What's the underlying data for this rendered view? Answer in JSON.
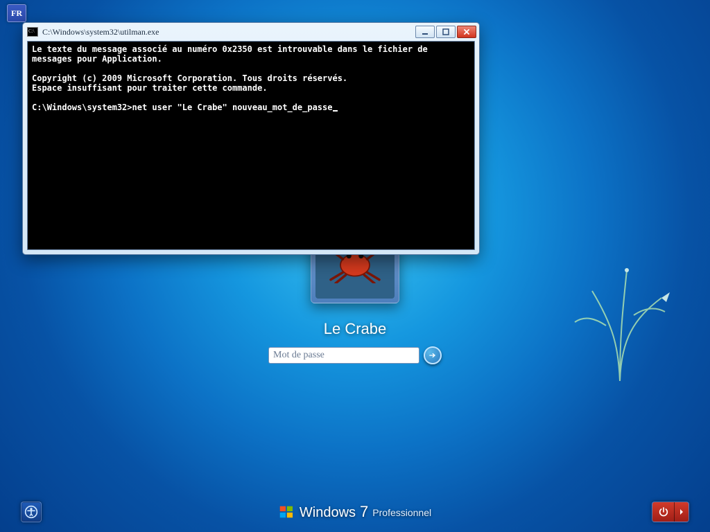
{
  "language_indicator": "FR",
  "login": {
    "username": "Le Crabe",
    "password_placeholder": "Mot de passe"
  },
  "branding": {
    "word1": "Windows",
    "word2": "7",
    "edition": "Professionnel"
  },
  "cmd": {
    "title": "C:\\Windows\\system32\\utilman.exe",
    "lines": [
      "Le texte du message associé au numéro 0x2350 est introuvable dans le fichier de messages pour Application.",
      "",
      "Copyright (c) 2009 Microsoft Corporation. Tous droits réservés.",
      "Espace insuffisant pour traiter cette commande.",
      "",
      "C:\\Windows\\system32>net user \"Le Crabe\" nouveau_mot_de_passe"
    ]
  }
}
